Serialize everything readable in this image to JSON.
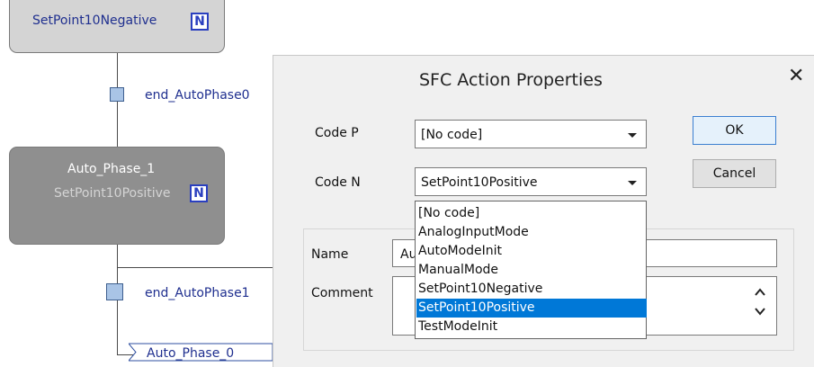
{
  "diagram": {
    "step_top": {
      "action": "SetPoint10Negative",
      "qualifier": "N"
    },
    "transition_0": {
      "label": "end_AutoPhase0"
    },
    "step_auto": {
      "name": "Auto_Phase_1",
      "action": "SetPoint10Positive",
      "qualifier": "N"
    },
    "transition_1": {
      "label": "end_AutoPhase1"
    },
    "jump": {
      "label": "Auto_Phase_0"
    }
  },
  "dialog": {
    "title": "SFC Action Properties",
    "close_glyph": "✕",
    "code_p": {
      "label": "Code P",
      "value": "[No code]"
    },
    "code_n": {
      "label": "Code N",
      "value": "SetPoint10Positive"
    },
    "ok_label": "OK",
    "cancel_label": "Cancel",
    "name": {
      "label": "Name",
      "value": "Au"
    },
    "comment": {
      "label": "Comment",
      "value": ""
    },
    "dropdown_options": [
      "[No code]",
      "AnalogInputMode",
      "AutoModeInit",
      "ManualMode",
      "SetPoint10Negative",
      "SetPoint10Positive",
      "TestModeInit"
    ],
    "dropdown_selected": "SetPoint10Positive"
  },
  "colors": {
    "selection": "#0078d7",
    "step_active": "#8f8f8f",
    "step_inactive": "#d4d4d4",
    "qualifier_border": "#2a3fbf",
    "diagram_text": "#1f2f8f"
  }
}
